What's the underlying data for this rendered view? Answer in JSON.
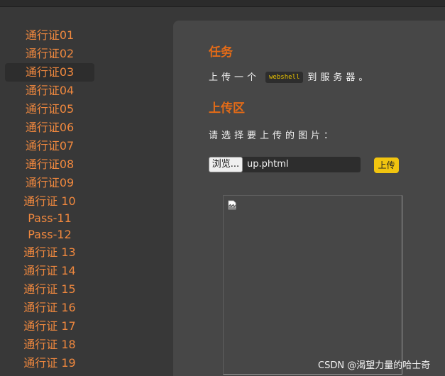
{
  "sidebar": {
    "items": [
      {
        "label": "通行证01"
      },
      {
        "label": "通行证02"
      },
      {
        "label": "通行证03"
      },
      {
        "label": "通行证04"
      },
      {
        "label": "通行证05"
      },
      {
        "label": "通行证06"
      },
      {
        "label": "通行证07"
      },
      {
        "label": "通行证08"
      },
      {
        "label": "通行证09"
      },
      {
        "label": "通行证 10"
      },
      {
        "label": "Pass-11"
      },
      {
        "label": "Pass-12"
      },
      {
        "label": "通行证 13"
      },
      {
        "label": "通行证 14"
      },
      {
        "label": "通行证 15"
      },
      {
        "label": "通行证 16"
      },
      {
        "label": "通行证 17"
      },
      {
        "label": "通行证 18"
      },
      {
        "label": "通行证 19"
      }
    ],
    "active": "通行证03"
  },
  "main": {
    "task_heading": "任务",
    "task_prefix": "上传一个",
    "task_code": "webshell",
    "task_suffix": "到服务器。",
    "upload_heading": "上传区",
    "choose_label": "请选择要上传的图片：",
    "browse_label": "浏览...",
    "file_name": "up.phtml",
    "upload_button": "上传"
  },
  "watermark": "CSDN @渴望力量的哈士奇",
  "colors": {
    "nav_text": "#f0883e",
    "heading": "#e46b17",
    "upload_button": "#f1c40f",
    "code_text": "#e8c200"
  },
  "icons": {
    "preview": "broken-image-icon"
  }
}
